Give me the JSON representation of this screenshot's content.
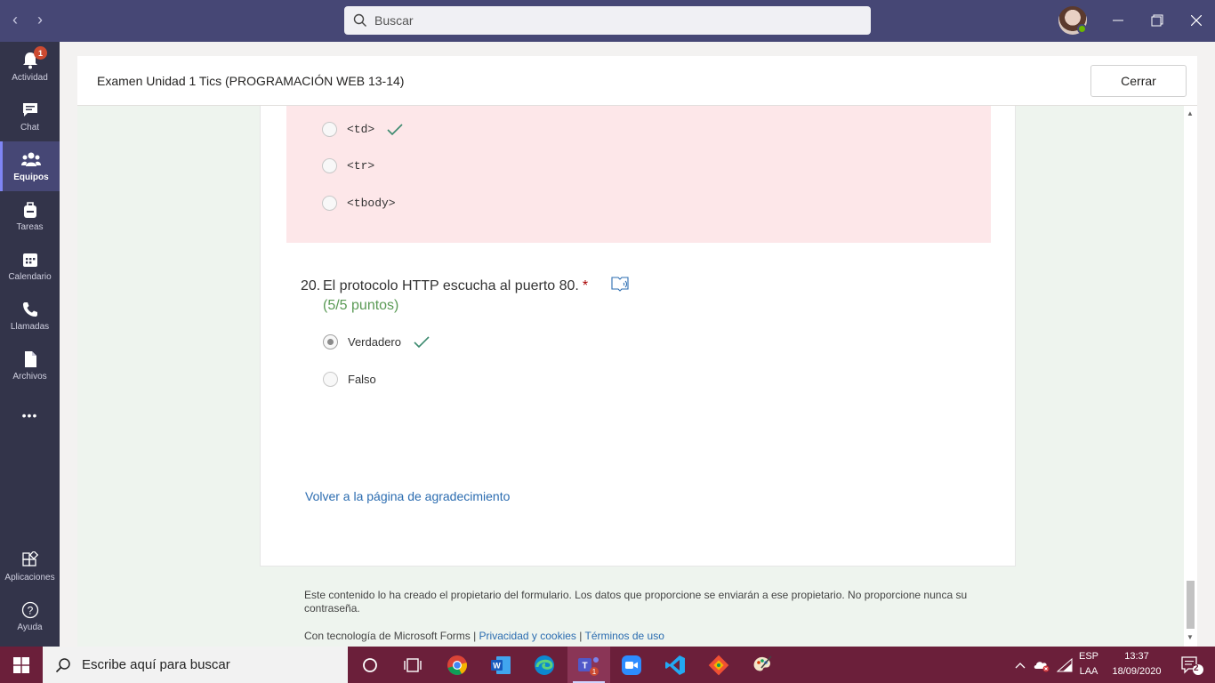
{
  "topbar": {
    "search_placeholder": "Buscar",
    "back_arrow": "‹",
    "forward_arrow": "›"
  },
  "rail": {
    "items": [
      {
        "label": "Actividad",
        "icon": "bell-icon",
        "badge": "1"
      },
      {
        "label": "Chat",
        "icon": "chat-icon"
      },
      {
        "label": "Equipos",
        "icon": "teams-icon",
        "active": true
      },
      {
        "label": "Tareas",
        "icon": "backpack-icon"
      },
      {
        "label": "Calendario",
        "icon": "calendar-icon"
      },
      {
        "label": "Llamadas",
        "icon": "phone-icon"
      },
      {
        "label": "Archivos",
        "icon": "file-icon"
      }
    ],
    "more": "•••",
    "apps_label": "Aplicaciones",
    "help_label": "Ayuda"
  },
  "dialog": {
    "title": "Examen Unidad 1 Tics (PROGRAMACIÓN WEB 13-14)",
    "close_label": "Cerrar"
  },
  "prev_question": {
    "options": [
      "<td>",
      "<tr>",
      "<tbody>"
    ],
    "correct_index": 0
  },
  "question": {
    "number": "20.",
    "text": "El protocolo HTTP escucha al puerto 80.",
    "required_mark": "*",
    "points": "(5/5 puntos)",
    "options": [
      "Verdadero",
      "Falso"
    ],
    "selected_index": 0,
    "correct_index": 0
  },
  "back_link": "Volver a la página de agradecimiento",
  "footer": {
    "notice": "Este contenido lo ha creado el propietario del formulario. Los datos que proporcione se enviarán a ese propietario. No proporcione nunca su contraseña.",
    "powered_by": "Con tecnología de Microsoft Forms | ",
    "privacy": "Privacidad y cookies",
    "separator": " | ",
    "terms": "Términos de uso"
  },
  "taskbar": {
    "search_placeholder": "Escribe aquí para buscar",
    "lang_top": "ESP",
    "lang_bottom": "LAA",
    "time": "13:37",
    "date": "18/09/2020",
    "notifications": "2"
  },
  "colors": {
    "teams_header": "#464775",
    "rail": "#33344a",
    "wrong_bg": "#fde7e9",
    "correct_check": "#3c8a6f",
    "points_green": "#5a9a55",
    "link_blue": "#2b6cb0",
    "taskbar": "#6b1f3a"
  }
}
